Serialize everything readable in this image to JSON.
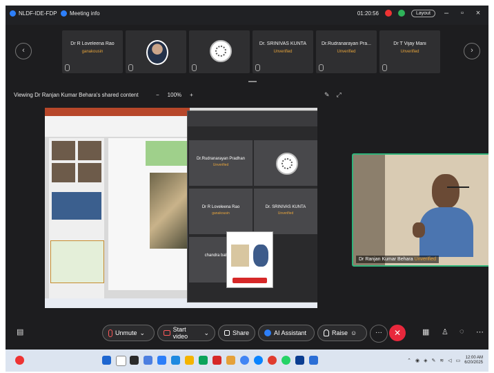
{
  "titlebar": {
    "meeting_name": "NLDF-IDE-FDP",
    "meeting_info": "Meeting info",
    "timer": "01:20:56",
    "layout_label": "Layout"
  },
  "participants": [
    {
      "name": "Dr R Loveleena Rao",
      "status": "ganakousin"
    },
    {
      "name": "",
      "status": ""
    },
    {
      "name": "",
      "status": ""
    },
    {
      "name": "Dr. SRINIVAS KUNTA",
      "status": "Unverified"
    },
    {
      "name": "Dr.Rudranarayan Pra...",
      "status": "Unverified"
    },
    {
      "name": "Dr T Vijay Mani",
      "status": "Unverified"
    }
  ],
  "viewing": {
    "label": "Viewing Dr Ranjan Kumar Behara's shared content",
    "zoom": "100%",
    "minus": "−",
    "plus": "+"
  },
  "shared_meeting_tiles": [
    {
      "name": "Dr.Rudranarayan Pradhan",
      "status": "Unverified"
    },
    {
      "name": "",
      "status": ""
    },
    {
      "name": "Dr R Loveleena Rao",
      "status": "ganakousin"
    },
    {
      "name": "Dr. SRINIVAS KUNTA",
      "status": "Unverified"
    },
    {
      "name": "chandra babu g...",
      "status": ""
    }
  ],
  "video": {
    "name": "Dr Ranjan Kumar Behara",
    "status": "Unverified"
  },
  "controls": {
    "unmute": "Unmute",
    "start_video": "Start video",
    "share": "Share",
    "ai_assistant": "AI Assistant",
    "raise": "Raise",
    "more": "···",
    "leave": "✕"
  },
  "clock": {
    "time": "12:00 AM",
    "date": "6/20/2025"
  },
  "colors": {
    "accent": "#2d7ff9",
    "leave": "#e8283c",
    "unverified": "#e6a43c",
    "active_speaker_border": "#2fb37a"
  }
}
